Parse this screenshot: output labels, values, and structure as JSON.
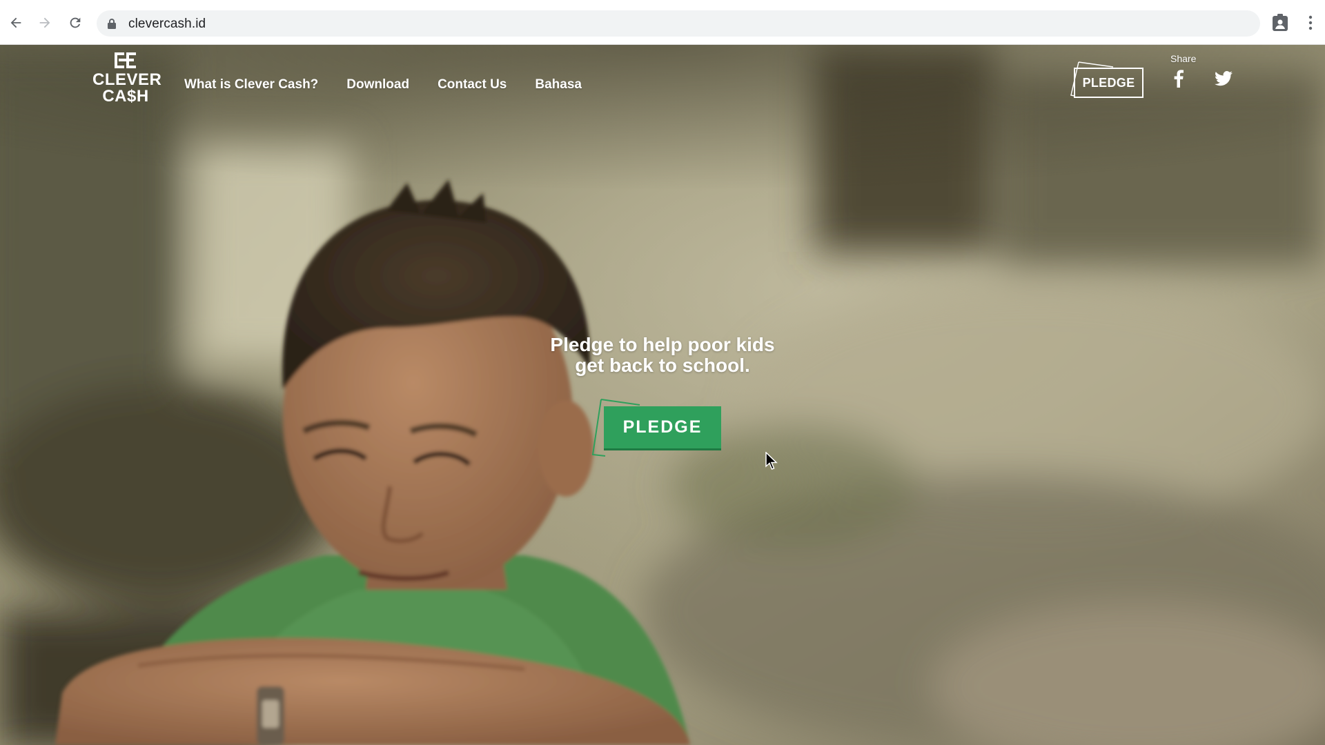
{
  "browser": {
    "url": "clevercash.id",
    "icons": [
      "back-icon",
      "forward-icon",
      "reload-icon",
      "lock-icon",
      "profile-icon",
      "menu-icon"
    ]
  },
  "site": {
    "logo": {
      "line1": "CLEVER",
      "line2": "CA$H"
    },
    "nav": [
      {
        "label": "What is Clever Cash?"
      },
      {
        "label": "Download"
      },
      {
        "label": "Contact Us"
      },
      {
        "label": "Bahasa"
      }
    ],
    "header_pledge_label": "PLEDGE",
    "share_label": "Share",
    "social_icons": [
      "facebook-icon",
      "twitter-icon"
    ]
  },
  "hero": {
    "heading_line1": "Pledge to help poor kids",
    "heading_line2": "get back to school.",
    "pledge_label": "PLEDGE"
  },
  "colors": {
    "accent_green": "#2fa05c",
    "accent_green_dark": "#1f7a43",
    "text_white": "#ffffff",
    "omnibox_bg": "#f1f3f4"
  }
}
